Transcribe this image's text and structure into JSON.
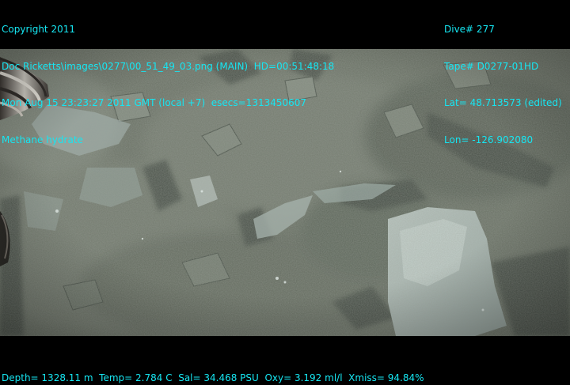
{
  "overlay": {
    "left_lines": [
      "Copyright 2011",
      "Doc Ricketts\\images\\0277\\00_51_49_03.png (MAIN)  HD=00:51:48:18",
      "Mon Aug 15 23:23:27 2011 GMT (local +7)  esecs=1313450607",
      "Methane hydrate"
    ],
    "right_lines": [
      "Dive# 277",
      "Tape# D0277-01HD",
      "Lat= 48.713573 (edited)",
      "Lon= -126.902080"
    ],
    "bottom_line": "Depth= 1328.11 m  Temp= 2.784 C  Sal= 34.468 PSU  Oxy= 3.192 ml/l  Xmiss= 94.84%",
    "text_color": "#16e6f2"
  },
  "scene": {
    "subject": "seafloor-with-methane-hydrate",
    "colors": {
      "sediment": "#6d7468",
      "sediment_dark": "#4a5249",
      "sediment_light": "#8e978b",
      "hydrate": "#b9c6c1",
      "hydrate_shadow": "#8fa09c",
      "hose_light": "#c9c7bf",
      "hose_dark": "#2e2a27"
    }
  }
}
